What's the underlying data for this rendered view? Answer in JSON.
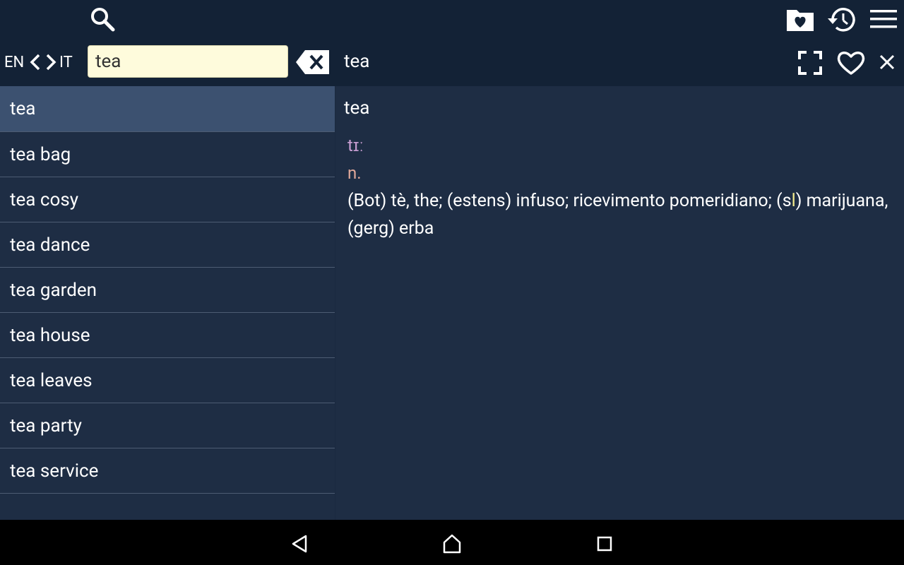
{
  "toolbar": {
    "icons": {
      "search": "search-icon",
      "favorites_folder": "heart-folder-icon",
      "history": "history-icon",
      "menu": "hamburger-menu-icon"
    }
  },
  "language": {
    "from": "EN",
    "to": "IT"
  },
  "search": {
    "value": "tea",
    "placeholder": ""
  },
  "detail_header": {
    "title": "tea"
  },
  "word_list": {
    "selected_index": 0,
    "items": [
      "tea",
      "tea bag",
      "tea cosy",
      "tea dance",
      "tea garden",
      "tea house",
      "tea leaves",
      "tea party",
      "tea service"
    ]
  },
  "entry": {
    "headword": "tea",
    "pronunciation": "tɪː",
    "part_of_speech": "n.",
    "definition_part1": "(Bot) tè, the; (estens) infuso; ricevimento pomeridiano; (s",
    "definition_highlight": "l",
    "definition_part2": ") marijuana, (gerg) erba"
  },
  "colors": {
    "background": "#1e2d44",
    "toolbar": "#132236",
    "selected_row": "#3c5170",
    "search_field": "#fefbdc",
    "pronunciation": "#c99fd3",
    "part_of_speech": "#e0a89a",
    "highlight": "#f2ea8c"
  }
}
